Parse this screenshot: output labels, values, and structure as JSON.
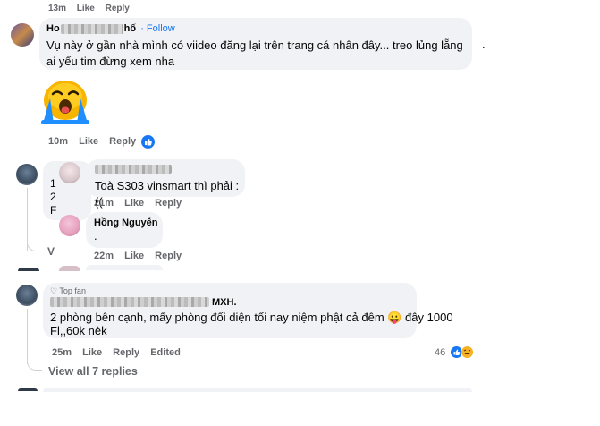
{
  "top_meta": [
    "13m",
    "Like",
    "Reply"
  ],
  "comment1": {
    "name_start": "Ho",
    "name_end": "hố",
    "follow": "· Follow",
    "text": "Vụ này ở gần nhà mình có viideo đăng lại trên trang cá nhân đây... treo lủng lẵng ai yếu tim đừng xem nha",
    "dot": ".",
    "time": "10m",
    "like": "Like",
    "reply": "Reply"
  },
  "reply1": {
    "text": "Toà S303 vinsmart thì phải :((",
    "time": "21m",
    "like": "Like",
    "reply": "Reply"
  },
  "reply2": {
    "name": "Hồng Nguyễn",
    "text": ".",
    "time": "22m",
    "like": "Like",
    "reply": "Reply"
  },
  "comment3": {
    "badge": "Top fan",
    "name_end": "MXH.",
    "text_line1": "2 phòng bên cạnh, mấy phòng đối diện tối nay niệm phật cả đêm 😛 đây 1000",
    "text_line2": "Fl,,60k nèk",
    "time": "25m",
    "like": "Like",
    "reply": "Reply",
    "edited": "Edited",
    "reaction_count": "46"
  },
  "view_replies": "View all 7 replies",
  "partial_letters": [
    "1",
    "2",
    "F",
    "V"
  ],
  "colors": {
    "like_blue": "#1877f2",
    "bubble": "#f0f2f5",
    "meta": "#65676b"
  }
}
